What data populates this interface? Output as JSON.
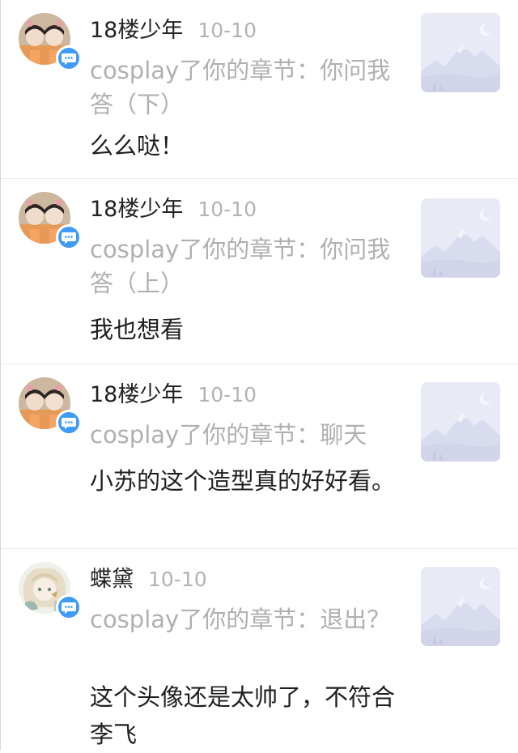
{
  "comments": [
    {
      "user": "18楼少年",
      "time": "10-10",
      "source": "cosplay了你的章节：你问我答（下）",
      "content": "么么哒！",
      "avatar_icon": "avatar-two-boys-icon"
    },
    {
      "user": "18楼少年",
      "time": "10-10",
      "source": "cosplay了你的章节：你问我答（上）",
      "content": "我也想看",
      "avatar_icon": "avatar-two-boys-icon"
    },
    {
      "user": "18楼少年",
      "time": "10-10",
      "source": "cosplay了你的章节：聊天",
      "content": "小苏的这个造型真的好好看。",
      "avatar_icon": "avatar-two-boys-icon"
    },
    {
      "user": "蝶黛",
      "time": "10-10",
      "source": "cosplay了你的章节：退出？",
      "content": "这个头像还是太帅了，不符合李飞",
      "avatar_icon": "avatar-anime-character-icon"
    }
  ],
  "icons": {
    "comment_badge": "comment-bubble-icon",
    "thumbnail": "image-placeholder-mountain-icon"
  },
  "colors": {
    "badge": "#3f9bf5",
    "thumbnail_bg": "#e8eaf6",
    "text_primary": "#1f1f1f",
    "text_secondary": "#b0b0b0"
  }
}
